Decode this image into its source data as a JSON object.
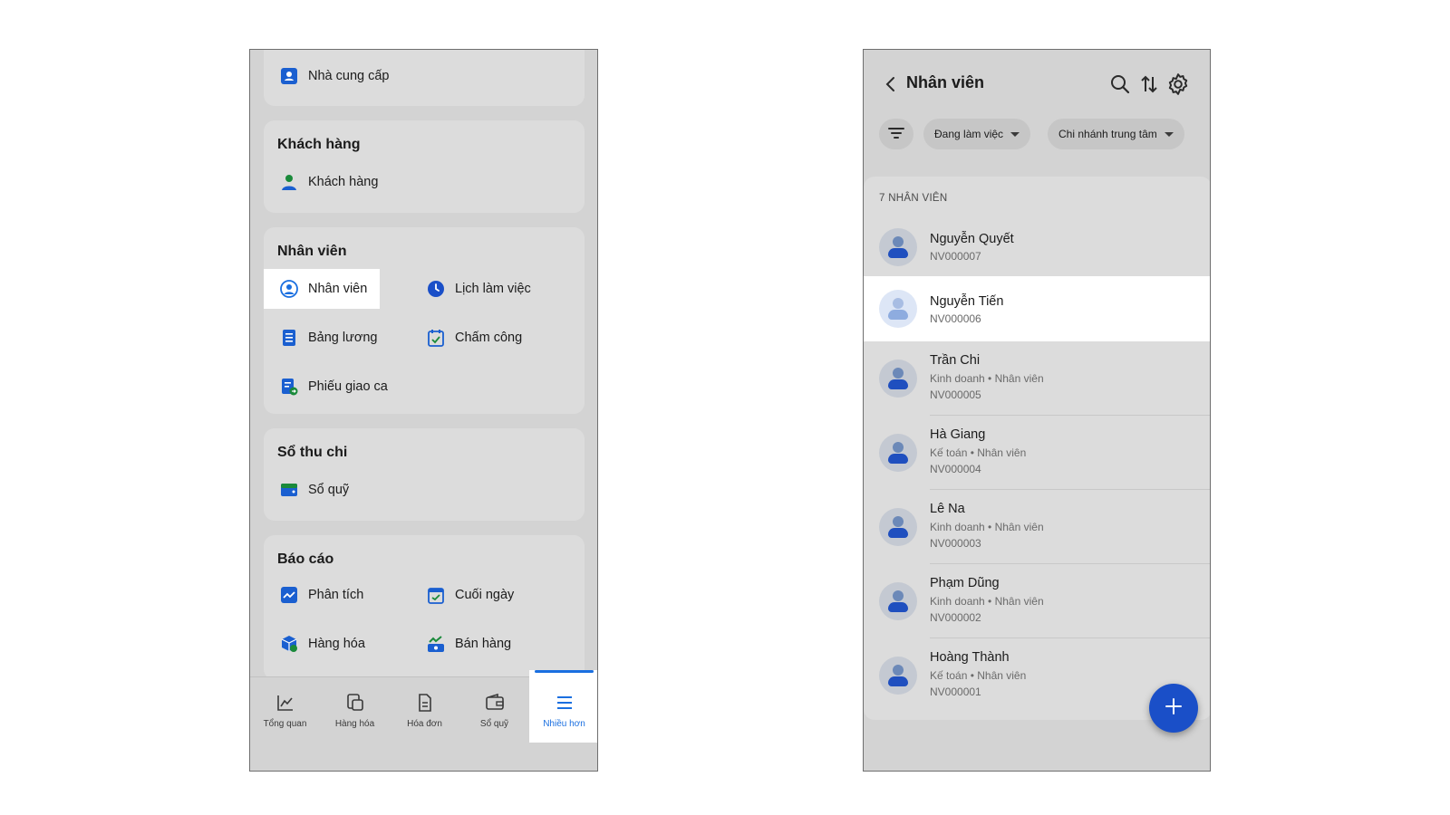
{
  "left_screen": {
    "cards": {
      "supplier": {
        "items": [
          {
            "label": "Nhà cung cấp",
            "icon": "supplier-icon"
          }
        ]
      },
      "customer": {
        "title": "Khách hàng",
        "items": [
          {
            "label": "Khách hàng",
            "icon": "customer-icon"
          }
        ]
      },
      "employee": {
        "title": "Nhân viên",
        "items": [
          {
            "label": "Nhân viên",
            "icon": "employee-icon",
            "active": true
          },
          {
            "label": "Lịch làm việc",
            "icon": "clock-icon"
          },
          {
            "label": "Bảng lương",
            "icon": "payroll-icon"
          },
          {
            "label": "Chấm công",
            "icon": "timekeeping-icon"
          },
          {
            "label": "Phiếu giao ca",
            "icon": "shift-handover-icon"
          }
        ]
      },
      "cashbook": {
        "title": "Sổ thu chi",
        "items": [
          {
            "label": "Sổ quỹ",
            "icon": "wallet-icon"
          }
        ]
      },
      "reports": {
        "title": "Báo cáo",
        "items": [
          {
            "label": "Phân tích",
            "icon": "analytics-icon"
          },
          {
            "label": "Cuối ngày",
            "icon": "end-of-day-icon"
          },
          {
            "label": "Hàng hóa",
            "icon": "goods-report-icon"
          },
          {
            "label": "Bán hàng",
            "icon": "sales-report-icon"
          }
        ]
      }
    },
    "bottom_nav": [
      {
        "label": "Tổng quan",
        "icon": "chart-icon"
      },
      {
        "label": "Hàng hóa",
        "icon": "goods-icon"
      },
      {
        "label": "Hóa đơn",
        "icon": "invoice-icon"
      },
      {
        "label": "Sổ quỹ",
        "icon": "wallet-icon"
      },
      {
        "label": "Nhiều hơn",
        "icon": "menu-icon",
        "active": true
      }
    ]
  },
  "right_screen": {
    "title": "Nhân viên",
    "filters": [
      {
        "label": "Đang làm việc"
      },
      {
        "label": "Chi nhánh trung tâm"
      }
    ],
    "count_label": "7 NHÂN VIÊN",
    "employees": [
      {
        "name": "Nguyễn Quyết",
        "code": "NV000007"
      },
      {
        "name": "Nguyễn Tiến",
        "code": "NV000006",
        "active": true
      },
      {
        "name": "Trần Chi",
        "role": "Kinh doanh • Nhân viên",
        "code": "NV000005"
      },
      {
        "name": "Hà Giang",
        "role": "Kế toán • Nhân viên",
        "code": "NV000004"
      },
      {
        "name": "Lê Na",
        "role": "Kinh doanh • Nhân viên",
        "code": "NV000003"
      },
      {
        "name": "Phạm Dũng",
        "role": "Kinh doanh • Nhân viên",
        "code": "NV000002"
      },
      {
        "name": "Hoàng Thành",
        "role": "Kế toán • Nhân viên",
        "code": "NV000001"
      }
    ],
    "fab_label": "+"
  },
  "colors": {
    "accent": "#1a6fe0",
    "fab": "#1a4fc8",
    "screen_bg": "#d3d3d3",
    "card_bg": "#dcdcdc"
  }
}
